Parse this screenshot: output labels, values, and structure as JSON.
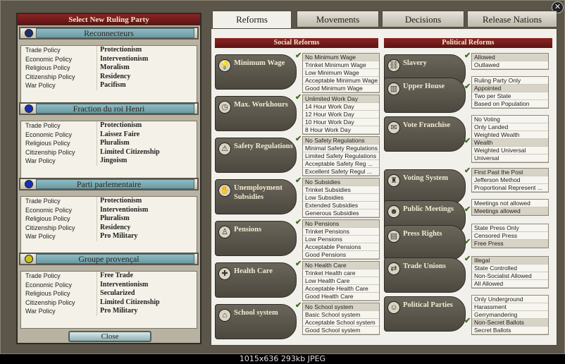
{
  "left": {
    "title": "Select New Ruling Party",
    "close_label": "Close",
    "parties": [
      {
        "name": "Reconnecteurs",
        "color": "#1c2f6d",
        "rows": [
          [
            "Trade Policy",
            "Protectionism"
          ],
          [
            "Economic Policy",
            "Interventionism"
          ],
          [
            "Religious Policy",
            "Moralism"
          ],
          [
            "Citizenship Policy",
            "Residency"
          ],
          [
            "War Policy",
            "Pacifism"
          ]
        ]
      },
      {
        "name": "Fraction du roi Henri",
        "color": "#1b2fb3",
        "rows": [
          [
            "Trade Policy",
            "Protectionism"
          ],
          [
            "Economic Policy",
            "Laissez Faire"
          ],
          [
            "Religious Policy",
            "Pluralism"
          ],
          [
            "Citizenship Policy",
            "Limited Citizenship"
          ],
          [
            "War Policy",
            "Jingoism"
          ]
        ]
      },
      {
        "name": "Parti parlementaire",
        "color": "#1b2fb3",
        "rows": [
          [
            "Trade Policy",
            "Protectionism"
          ],
          [
            "Economic Policy",
            "Interventionism"
          ],
          [
            "Religious Policy",
            "Pluralism"
          ],
          [
            "Citizenship Policy",
            "Residency"
          ],
          [
            "War Policy",
            "Pro Military"
          ]
        ]
      },
      {
        "name": "Groupe provençal",
        "color": "#c8c21c",
        "rows": [
          [
            "Trade Policy",
            "Free Trade"
          ],
          [
            "Economic Policy",
            "Interventionism"
          ],
          [
            "Religious Policy",
            "Secularized"
          ],
          [
            "Citizenship Policy",
            "Limited Citizenship"
          ],
          [
            "War Policy",
            "Pro Military"
          ]
        ]
      }
    ]
  },
  "tabs": [
    "Reforms",
    "Movements",
    "Decisions",
    "Release Nations"
  ],
  "columns": {
    "social": "Social Reforms",
    "political": "Political Reforms"
  },
  "social": [
    {
      "name": "Minimum Wage",
      "icon": "lightbulb",
      "sel": 0,
      "options": [
        "No Minimum Wage",
        "Trinket Minimum Wage",
        "Low Minimum Wage",
        "Acceptable Minimum Wage",
        "Good Minimum Wage"
      ]
    },
    {
      "name": "Max. Workhours",
      "icon": "clock",
      "sel": 0,
      "options": [
        "Unlimited Work Day",
        "14 Hour Work Day",
        "12 Hour Work Day",
        "10 Hour Work Day",
        "8 Hour Work Day"
      ]
    },
    {
      "name": "Safety Regulations",
      "icon": "warning",
      "sel": 0,
      "options": [
        "No Safety Regulations",
        "Minimal Safety Regulations",
        "Limited Safety Regulations",
        "Acceptable Safety Reg ...",
        "Excellent Safety Regul ..."
      ]
    },
    {
      "name": "Unemployment Subsidies",
      "icon": "hand",
      "sel": 0,
      "options": [
        "No Subsidies",
        "Trinket Subsidies",
        "Low Subsidies",
        "Extended Subsidies",
        "Generous Subsidies"
      ]
    },
    {
      "name": "Pensions",
      "icon": "elder",
      "sel": 0,
      "options": [
        "No Pensions",
        "Trinket Pensions",
        "Low Pensions",
        "Acceptable Pensions",
        "Good Pensions"
      ]
    },
    {
      "name": "Health Care",
      "icon": "medkit",
      "sel": 0,
      "options": [
        "No Health Care",
        "Trinket Health care",
        "Low Health Care",
        "Acceptable Health Care",
        "Good Health Care"
      ]
    },
    {
      "name": "School system",
      "icon": "school",
      "sel": 0,
      "options": [
        "No School system",
        "Basic School system",
        "Acceptable School system",
        "Good School system"
      ]
    }
  ],
  "political": [
    {
      "name": "Slavery",
      "icon": "chain",
      "sel": 0,
      "options": [
        "Allowed",
        "Outlawed"
      ]
    },
    {
      "name": "Upper House",
      "icon": "building",
      "sel": 1,
      "options": [
        "Ruling Party Only",
        "Appointed",
        "Two per State",
        "Based on Population"
      ]
    },
    {
      "name": "Vote Franchise",
      "icon": "ballot",
      "sel": 3,
      "options": [
        "No Voting",
        "Only Landed",
        "Weighted Wealth",
        "Wealth",
        "Weighted Universal",
        "Universal"
      ]
    },
    {
      "name": "Voting System",
      "icon": "chair",
      "sel": 0,
      "options": [
        "First Past the Post",
        "Jefferson Method",
        "Proportional Represent ..."
      ]
    },
    {
      "name": "Public Meetings",
      "icon": "crowd",
      "sel": 1,
      "options": [
        "Meetings not allowed",
        "Meetings allowed"
      ]
    },
    {
      "name": "Press Rights",
      "icon": "newspaper",
      "sel": 2,
      "options": [
        "State Press Only",
        "Censored Press",
        "Free Press"
      ]
    },
    {
      "name": "Trade Unions",
      "icon": "handshake",
      "sel": 0,
      "options": [
        "Illegal",
        "State Controlled",
        "Non-Socialist Allowed",
        "All Allowed"
      ]
    },
    {
      "name": "Political Parties",
      "icon": "people",
      "sel": 3,
      "options": [
        "Only Underground",
        "Harassment",
        "Gerrymandering",
        "Non-Secret Ballots",
        "Secret Ballots"
      ]
    }
  ],
  "caption": "1015x636  293kb  JPEG",
  "close_icon_label": "✕"
}
